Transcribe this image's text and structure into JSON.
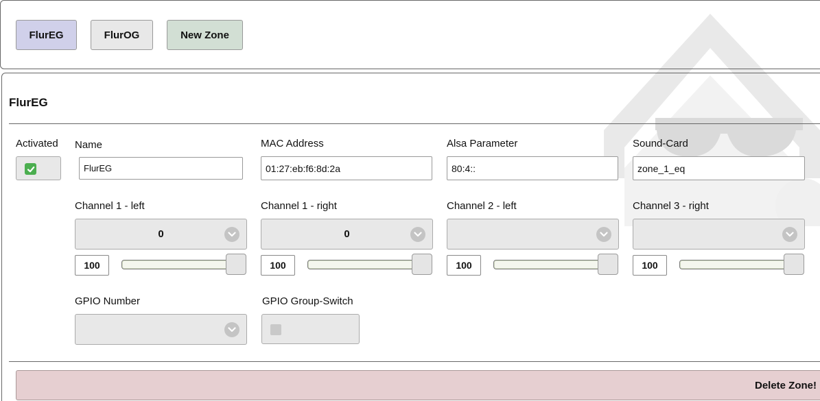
{
  "zone_tabs": [
    {
      "label": "FlurEG",
      "color": "#d0d0ea"
    },
    {
      "label": "FlurOG",
      "color": "#e8e8e8"
    },
    {
      "label": "New Zone",
      "color": "#d2dfd4"
    }
  ],
  "zone": {
    "title": "FlurEG",
    "activated_label": "Activated",
    "activated": true,
    "name_label": "Name",
    "name_value": "FlurEG",
    "mac_label": "MAC Address",
    "mac_value": "01:27:eb:f6:8d:2a",
    "alsa_label": "Alsa Parameter",
    "alsa_value": "80:4::",
    "soundcard_label": "Sound-Card",
    "soundcard_value": "zone_1_eq"
  },
  "channels": [
    {
      "label": "Channel 1 - left",
      "selected": "0",
      "volume": "100",
      "volume_level": 1.0
    },
    {
      "label": "Channel 1 - right",
      "selected": "0",
      "volume": "100",
      "volume_level": 1.0
    },
    {
      "label": "Channel 2 - left",
      "selected": "",
      "volume": "100",
      "volume_level": 1.0
    },
    {
      "label": "Channel 3 - right",
      "selected": "",
      "volume": "100",
      "volume_level": 1.0
    }
  ],
  "gpio": {
    "number_label": "GPIO Number",
    "number_selected": "",
    "group_switch_label": "GPIO Group-Switch",
    "group_switch_checked": false
  },
  "delete_label": "Delete Zone!",
  "colors": {
    "accent_check": "#4bae4f",
    "delete_bg": "#e6cfd1",
    "watermark": "#e6e6e6"
  },
  "icons": {
    "watermark": "house-sunglasses-logo",
    "select": "chevron-down-icon",
    "checkbox": "check-icon"
  }
}
